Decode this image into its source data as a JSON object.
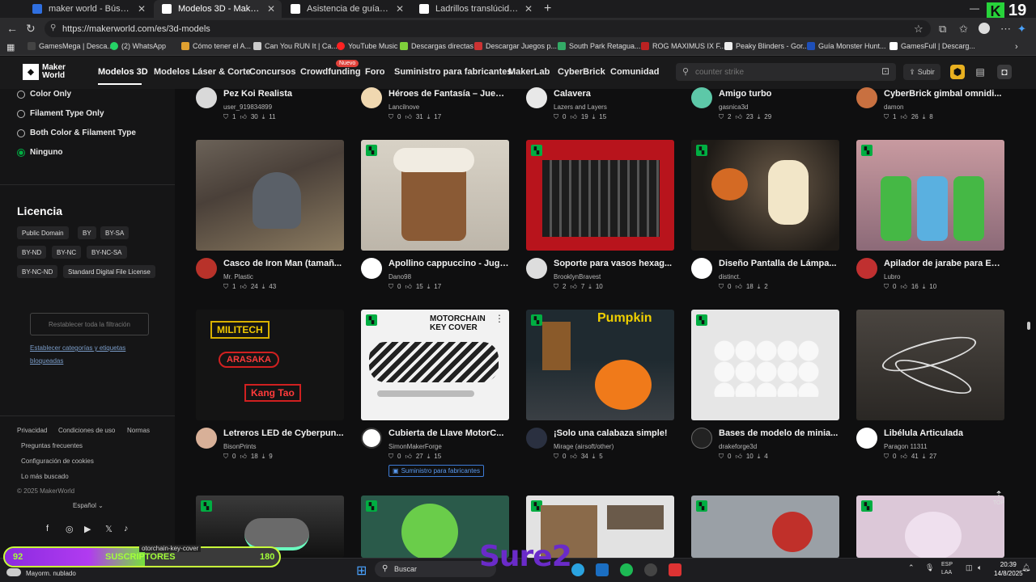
{
  "browser": {
    "tabs": [
      {
        "title": "maker world - Búsqueda",
        "active": false
      },
      {
        "title": "Modelos 3D - MakerWorld",
        "active": true
      },
      {
        "title": "Asistencia de guía de aguja magnét",
        "active": false
      },
      {
        "title": "Ladrillos translúcidos - muros func",
        "active": false
      }
    ],
    "url": "https://makerworld.com/es/3d-models",
    "k_badge": "K",
    "k_count": "19",
    "bookmarks": [
      "GamesMega | Desca...",
      "(2) WhatsApp",
      "Cómo tener el A...",
      "Can You RUN It | Ca...",
      "YouTube Music",
      "Descargas directas",
      "Descargar Juegos p...",
      "South Park Retagua...",
      "ROG MAXIMUS IX F...",
      "Peaky Blinders - Gor...",
      "Guía Monster Hunt...",
      "GamesFull | Descarg..."
    ]
  },
  "site": {
    "logo_line1": "Maker",
    "logo_line2": "World",
    "nav": [
      "Modelos 3D",
      "Modelos Láser & Corte",
      "Concursos",
      "Crowdfunding",
      "Foro",
      "Suministro para fabricantes",
      "MakerLab",
      "CyberBrick",
      "Comunidad"
    ],
    "nuevo": "Nuevo",
    "search_placeholder": "counter strike",
    "upload_label": "Subir"
  },
  "sidebar": {
    "options": [
      {
        "label": "Color Only",
        "selected": false
      },
      {
        "label": "Filament Type Only",
        "selected": false
      },
      {
        "label": "Both Color & Filament Type",
        "selected": false
      },
      {
        "label": "Ninguno",
        "selected": true
      }
    ],
    "license_title": "Licencia",
    "licenses": [
      "Public Domain",
      "BY",
      "BY-SA",
      "BY-ND",
      "BY-NC",
      "BY-NC-SA",
      "BY-NC-ND",
      "Standard Digital File License"
    ],
    "reset": "Restablecer toda la filtración",
    "set_categories": "Establecer categorías y etiquetas bloqueadas",
    "footer_links": [
      "Privacidad",
      "Condiciones de uso",
      "Normas",
      "Preguntas frecuentes",
      "Configuración de cookies",
      "Lo más buscado"
    ],
    "copyright": "© 2025 MakerWorld",
    "language": "Español"
  },
  "grid": {
    "rows": [
      [
        {
          "title": "Pez Koi Realista",
          "author": "user_919834899",
          "boosts": "1",
          "likes": "30",
          "downloads": "11"
        },
        {
          "title": "Héroes de Fantasía – Juego...",
          "author": "Lancilnove",
          "boosts": "0",
          "likes": "31",
          "downloads": "17"
        },
        {
          "title": "Calavera",
          "author": "Lazers and Layers",
          "boosts": "0",
          "likes": "19",
          "downloads": "15"
        },
        {
          "title": "Amigo turbo",
          "author": "gasnica3d",
          "boosts": "2",
          "likes": "23",
          "downloads": "29"
        },
        {
          "title": "CyberBrick gimbal omnidi...",
          "author": "damon",
          "boosts": "1",
          "likes": "26",
          "downloads": "8"
        }
      ],
      [
        {
          "title": "Casco de Iron Man (tamañ...",
          "author": "Mr. Plastic",
          "boosts": "1",
          "likes": "24",
          "downloads": "43"
        },
        {
          "title": "Apollino cappuccino - Jugu...",
          "author": "Dano98",
          "boosts": "0",
          "likes": "15",
          "downloads": "17"
        },
        {
          "title": "Soporte para vasos hexag...",
          "author": "BrooklynBravest",
          "boosts": "2",
          "likes": "7",
          "downloads": "10"
        },
        {
          "title": "Diseño Pantalla de Lámpa...",
          "author": "distinct.",
          "boosts": "0",
          "likes": "18",
          "downloads": "2"
        },
        {
          "title": "Apilador de jarabe para ES...",
          "author": "Lubro",
          "boosts": "0",
          "likes": "16",
          "downloads": "10"
        }
      ],
      [
        {
          "title": "Letreros LED de Cyberpun...",
          "author": "BisonPrints",
          "boosts": "0",
          "likes": "18",
          "downloads": "9"
        },
        {
          "title": "Cubierta de Llave MotorC...",
          "author": "SimonMakerForge",
          "boosts": "0",
          "likes": "27",
          "downloads": "15"
        },
        {
          "title": "¡Solo una calabaza simple!",
          "author": "Mirage (airsoft/other)",
          "boosts": "0",
          "likes": "34",
          "downloads": "5"
        },
        {
          "title": "Bases de modelo de minia...",
          "author": "drakeforge3d",
          "boosts": "0",
          "likes": "10",
          "downloads": "4"
        },
        {
          "title": "Libélula Articulada",
          "author": "Paragon 11311",
          "boosts": "0",
          "likes": "41",
          "downloads": "27"
        }
      ]
    ],
    "supply_badge": "Suministro para fabricantes",
    "top_label": "TOP",
    "thumb_text": {
      "militech": "MILITECH",
      "arasaka": "ARASAKA",
      "kangtao": "Kang Tao",
      "motorchain": "MOTORCHAIN KEY COVER",
      "pumpkin": "Pumpkin"
    }
  },
  "overlay": {
    "subs_left": "92",
    "subs_label": "SUSCRIPTORES",
    "subs_right": "180",
    "subs_progress": 0.51,
    "url_tooltip": "otorchain-key-cover",
    "watermark": "Sure2"
  },
  "taskbar": {
    "weather": "Mayorm. nublado",
    "search": "Buscar",
    "lang1": "ESP",
    "lang2": "LAA",
    "time": "20:39",
    "date": "14/8/2025"
  }
}
